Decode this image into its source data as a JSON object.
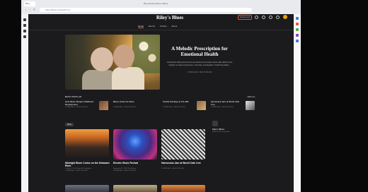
{
  "browser": {
    "window_title": "Blog Weekly Riley's Blues",
    "tab_label": "Blue",
    "address": "https://blues.substack.com"
  },
  "site": {
    "title": "Riley's Blues",
    "dashboard_label": "Dashboard",
    "nav": [
      "Home",
      "Events",
      "Archive",
      "About"
    ]
  },
  "hero": {
    "title": "A Melodic Prescription for Emotional Health",
    "description": "Introduction Retirement homes are vibrant communities where older adults come together to share experiences, memories, and laughter. Amidst the golden...",
    "meta": "23 MINS AGO • RILEY'S BLUES"
  },
  "popular": {
    "label": "MOST POPULAR",
    "view_all": "VIEW ALL",
    "items": [
      {
        "title": "How Music Shapes Childhood Development",
        "meta": "23 MINS AGO • RILEY'S BLUES"
      },
      {
        "title": "Blues Under the Stars",
        "meta": "23 MINS AGO • RILEY'S BLUES"
      },
      {
        "title": "Soulful Sundays at The Mill",
        "meta": "23 MINS AGO • RILEY'S BLUES"
      },
      {
        "title": "Harmonica Jam at World Cafe Live",
        "meta": "23 MINS AGO • RILEY'S BLUES"
      }
    ]
  },
  "latest": {
    "pill": "New",
    "cards": [
      {
        "title": "Midnight Blues Cruise on the Delaware River",
        "meta": "October 10, 2024 Spirit of Philadelphia",
        "meta2": "23 MINS AGO • RILEY'S BLUES"
      },
      {
        "title": "Electric Blues Revival",
        "meta": "September 12, 2024 The Fillmore",
        "meta2": "23 MINS AGO • RILEY'S BLUES"
      },
      {
        "title": "Harmonica Jam at World Cafe Live",
        "meta": "23 MINS AGO • RILEY'S BLUES",
        "meta2": ""
      }
    ]
  },
  "sidebar": {
    "title": "Riley's Blues",
    "subtitle": "A Blog of All Things Blues"
  },
  "colors": {
    "accent": "#e05a3a",
    "page_bg": "#1b1a1d",
    "avatar": "#e8a400"
  }
}
